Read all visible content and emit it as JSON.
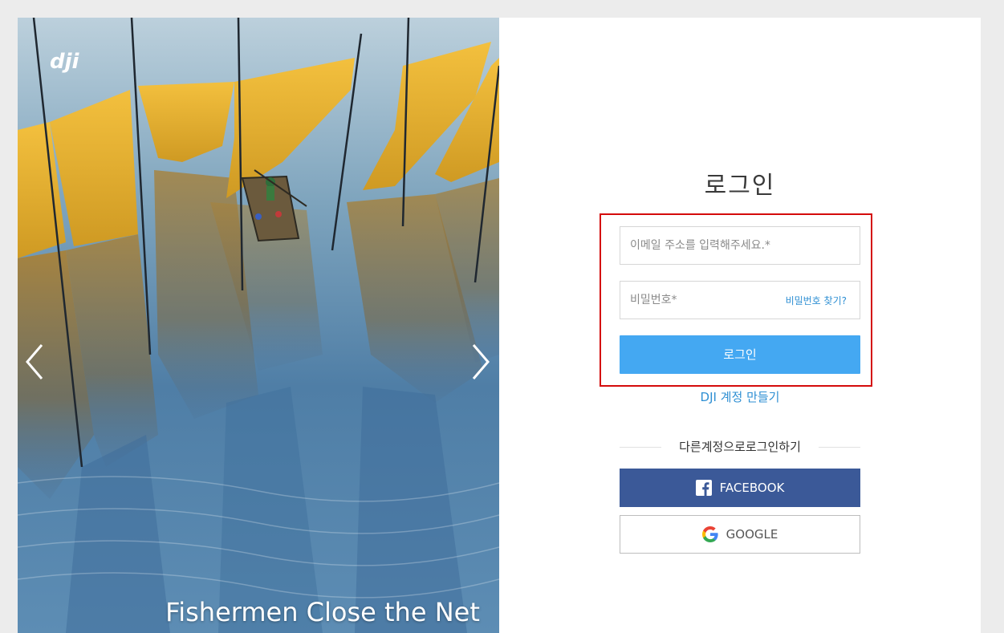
{
  "hero": {
    "caption": "Fishermen Close the Net",
    "logo": "dji"
  },
  "login": {
    "title": "로그인",
    "email_placeholder": "이메일 주소를 입력해주세요.*",
    "password_placeholder": "비밀번호*",
    "forgot_password": "비밀번호 찾기?",
    "login_button": "로그인",
    "create_account": "DJI 계정 만들기",
    "alt_login_label": "다른계정으로로그인하기",
    "facebook_label": "FACEBOOK",
    "google_label": "GOOGLE"
  },
  "colors": {
    "login_button": "#44a8f2",
    "link": "#2e8fd3",
    "facebook": "#3b5998",
    "highlight_border": "#d40b0b"
  },
  "icons": [
    "dji-logo",
    "chevron-left-icon",
    "chevron-right-icon",
    "facebook-icon",
    "google-icon"
  ]
}
